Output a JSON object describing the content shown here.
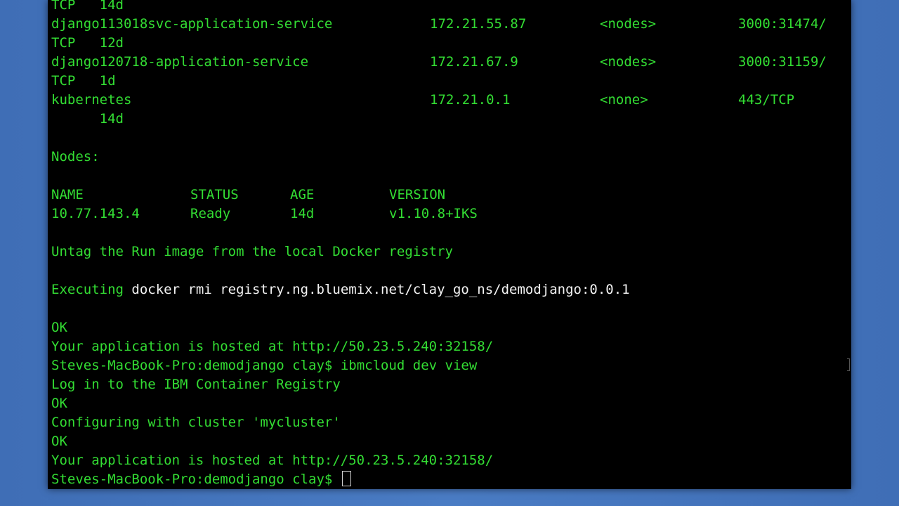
{
  "terminal": {
    "services": [
      {
        "tail": "TCP   14d"
      },
      {
        "name": "django113018svc-application-service",
        "ip": "172.21.55.87",
        "external": "<nodes>",
        "ports": "3000:31474/",
        "tail": "TCP   12d"
      },
      {
        "name": "django120718-application-service",
        "ip": "172.21.67.9",
        "external": "<nodes>",
        "ports": "3000:31159/",
        "tail": "TCP   1d"
      },
      {
        "name": "kubernetes",
        "ip": "172.21.0.1",
        "external": "<none>",
        "ports": "443/TCP",
        "tail": "      14d"
      }
    ],
    "nodes_heading": "Nodes:",
    "nodes_header": {
      "name": "NAME",
      "status": "STATUS",
      "age": "AGE",
      "version": "VERSION"
    },
    "nodes_row": {
      "name": "10.77.143.4",
      "status": "Ready",
      "age": "14d",
      "version": "v1.10.8+IKS"
    },
    "untag_msg": "Untag the Run image from the local Docker registry",
    "exec_label": "Executing",
    "exec_cmd": "docker rmi registry.ng.bluemix.net/clay_go_ns/demodjango:0.0.1",
    "ok1": "OK",
    "hosted1": "Your application is hosted at http://50.23.5.240:32158/",
    "prompt1": "Steves-MacBook-Pro:demodjango clay$",
    "cmd1": "ibmcloud dev view",
    "login_msg": "Log in to the IBM Container Registry",
    "ok2": "OK",
    "config_msg": "Configuring with cluster 'mycluster'",
    "ok3": "OK",
    "hosted2": "Your application is hosted at http://50.23.5.240:32158/",
    "prompt2": "Steves-MacBook-Pro:demodjango clay$"
  },
  "colors": {
    "background": "#4a7cc4",
    "terminal_bg": "#000000",
    "text_green": "#33dd33",
    "text_white": "#f2f2f2"
  }
}
